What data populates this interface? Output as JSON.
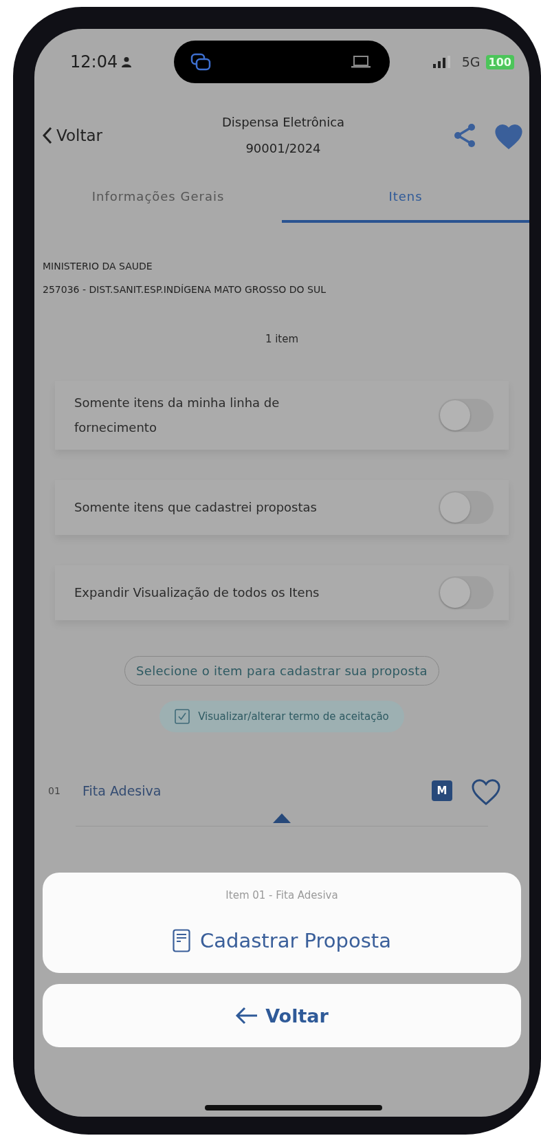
{
  "status_bar": {
    "time": "12:04",
    "network": "5G",
    "battery": "100"
  },
  "header": {
    "back": "Voltar",
    "title": "Dispensa Eletrônica",
    "number": "90001/2024",
    "favorite": true
  },
  "tabs": [
    {
      "label": "Informações Gerais",
      "selected": false
    },
    {
      "label": "Itens",
      "selected": true
    }
  ],
  "organization": {
    "name": "MINISTERIO DA SAUDE",
    "unit": "257036 - DIST.SANIT.ESP.INDÍGENA MATO GROSSO DO SUL"
  },
  "item_count": "1 item",
  "filters": [
    {
      "label": "Somente itens da minha linha de fornecimento",
      "on": false
    },
    {
      "label": "Somente itens que cadastrei propostas",
      "on": false
    },
    {
      "label": "Expandir Visualização de todos os Itens",
      "on": false
    }
  ],
  "select_hint": "Selecione o item para cadastrar sua proposta",
  "terms": {
    "label": "Visualizar/alterar termo de aceitação",
    "checked": true
  },
  "items": [
    {
      "number": "01",
      "name": "Fita Adesiva",
      "badge": "M",
      "favorite": false,
      "expanded": true
    }
  ],
  "action_sheet": {
    "title": "Item 01 - Fita Adesiva",
    "action": "Cadastrar Proposta",
    "cancel": "Voltar"
  }
}
